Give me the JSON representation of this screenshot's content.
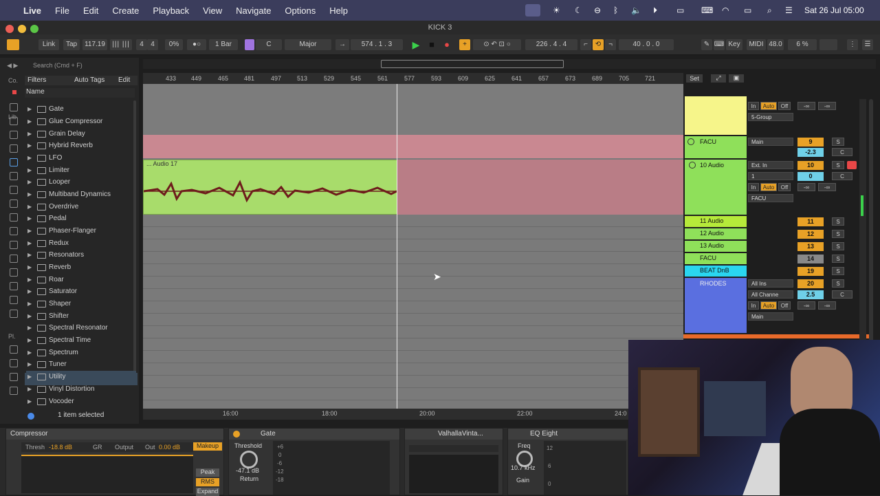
{
  "menubar": {
    "app": "Live",
    "items": [
      "File",
      "Edit",
      "Create",
      "Playback",
      "View",
      "Navigate",
      "Options",
      "Help"
    ],
    "datetime": "Sat 26 Jul  05:00"
  },
  "window": {
    "title": "KICK 3"
  },
  "transport": {
    "link": "Link",
    "tap": "Tap",
    "tempo": "117.19",
    "signature_num": "4",
    "signature_den": "4",
    "swing": "0%",
    "quantize": "1 Bar",
    "key": "C",
    "scale": "Major",
    "position": "574 .   1 .   3",
    "loop_start": "226 .   4 .   4",
    "loop_length": "40 .   0 .   0",
    "key_label": "Key",
    "midi_label": "MIDI",
    "sample_rate": "48.0",
    "cpu": "6 %"
  },
  "browser": {
    "search_placeholder": "Search (Cmd + F)",
    "filters": "Filters",
    "auto_tags": "Auto Tags",
    "edit": "Edit",
    "column_name": "Name",
    "side_labels": [
      "Co.",
      "Lib.",
      "Pl."
    ],
    "items": [
      "Gate",
      "Glue Compressor",
      "Grain Delay",
      "Hybrid Reverb",
      "LFO",
      "Limiter",
      "Looper",
      "Multiband Dynamics",
      "Overdrive",
      "Pedal",
      "Phaser-Flanger",
      "Redux",
      "Resonators",
      "Reverb",
      "Roar",
      "Saturator",
      "Shaper",
      "Shifter",
      "Spectral Resonator",
      "Spectral Time",
      "Spectrum",
      "Tuner",
      "Utility",
      "Vinyl Distortion",
      "Vocoder"
    ],
    "selected_item": "Utility",
    "status": "1 item selected"
  },
  "ruler": {
    "bars": [
      "433",
      "449",
      "465",
      "481",
      "497",
      "513",
      "529",
      "545",
      "561",
      "577",
      "593",
      "609",
      "625",
      "641",
      "657",
      "673",
      "689",
      "705",
      "721"
    ],
    "times": [
      "16:00",
      "18:00",
      "20:00",
      "22:00",
      "24:0"
    ],
    "set_label": "Set"
  },
  "arrangement": {
    "clip_name": "... Audio 17"
  },
  "tracks": [
    {
      "name": "",
      "number": "",
      "color": "#f6f58a"
    },
    {
      "name": "FACU",
      "number": "9",
      "color": "#8fe05a",
      "volume": "-2.3",
      "input": "Main"
    },
    {
      "name": "10 Audio",
      "number": "10",
      "color": "#8fe05a",
      "volume": "0",
      "input": "Ext. In",
      "channel": "1",
      "output": "FACU"
    },
    {
      "name": "11 Audio",
      "number": "11",
      "color": "#b6ea3a"
    },
    {
      "name": "12 Audio",
      "number": "12",
      "color": "#8fe05a"
    },
    {
      "name": "13 Audio",
      "number": "13",
      "color": "#8fe05a"
    },
    {
      "name": "FACU",
      "number": "14",
      "color": "#8fe05a"
    },
    {
      "name": "BEAT DnB",
      "number": "19",
      "color": "#2ad6f0"
    },
    {
      "name": "RHODES",
      "number": "20",
      "color": "#5a6fe0",
      "input": "All Ins",
      "channel": "All Channe",
      "volume": "2.5",
      "output": "Main"
    }
  ],
  "mixer_labels": {
    "in": "In",
    "auto": "Auto",
    "off": "Off",
    "group": "5-Group",
    "s": "S",
    "c": "C",
    "inf": "-∞"
  },
  "devices": {
    "compressor": {
      "title": "Compressor",
      "thresh_label": "Thresh",
      "thresh": "-18.8 dB",
      "gr": "GR",
      "output": "Output",
      "out_label": "Out",
      "out": "0.00 dB",
      "makeup": "Makeup",
      "peak": "Peak",
      "rms": "RMS",
      "expand": "Expand"
    },
    "gate": {
      "title": "Gate",
      "threshold_label": "Threshold",
      "threshold": "-47.1 dB",
      "return_label": "Return",
      "scale": [
        "+6",
        "0",
        "-6",
        "-12",
        "-18"
      ]
    },
    "valhalla": {
      "title": "ValhallaVinta..."
    },
    "eq": {
      "title": "EQ Eight",
      "freq_label": "Freq",
      "freq": "10.7 kHz",
      "gain_label": "Gain",
      "scale": [
        "12",
        "6",
        "0"
      ]
    }
  }
}
